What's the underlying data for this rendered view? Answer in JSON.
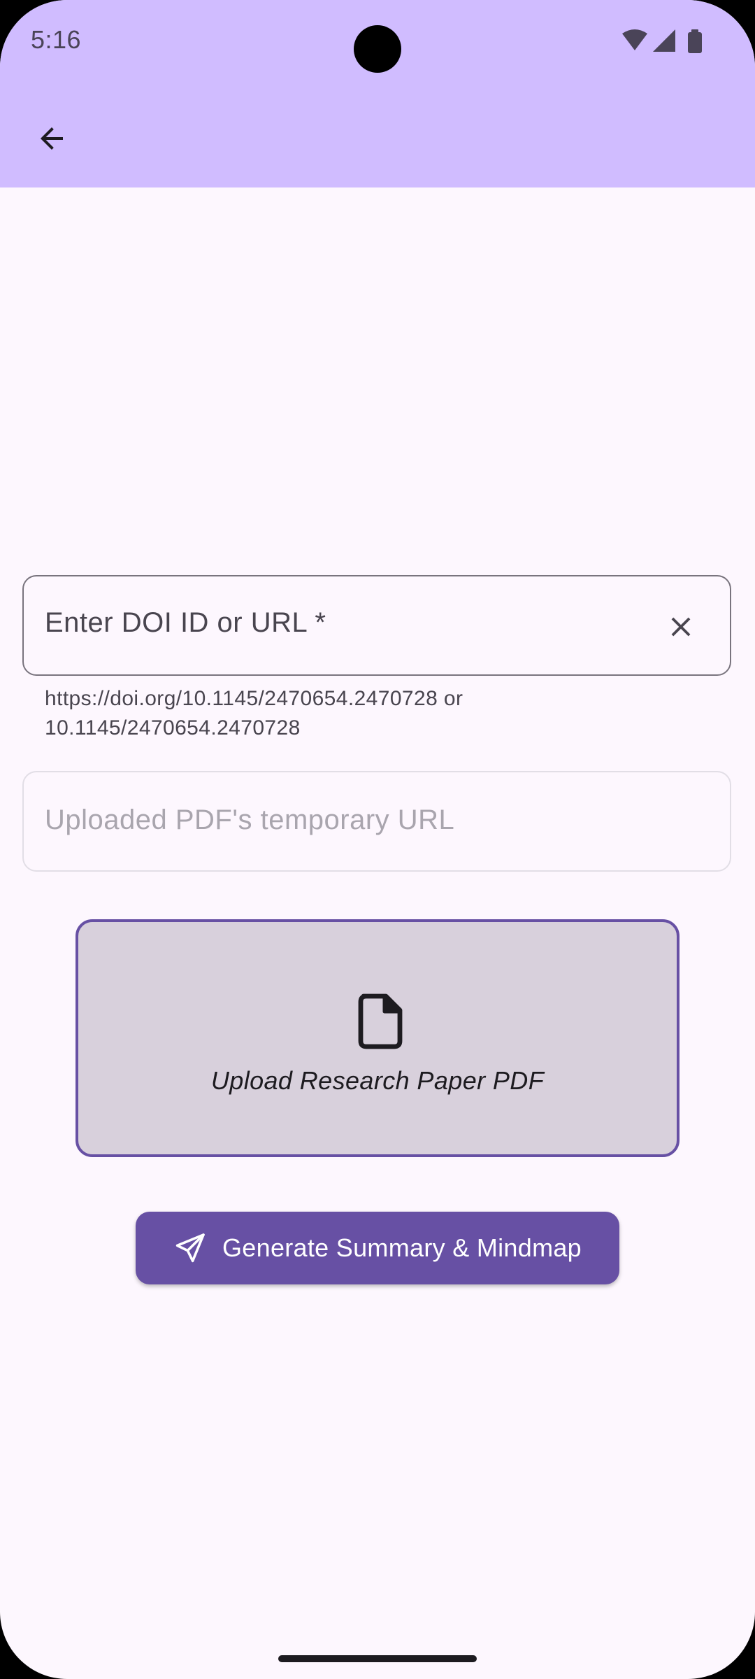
{
  "status_bar": {
    "time": "5:16"
  },
  "app_bar": {
    "back_icon": "arrow-back-icon",
    "background_color": "#D0BCFF"
  },
  "doi_input": {
    "label": "Enter DOI ID or URL *",
    "value": "",
    "helper_text": "https://doi.org/10.1145/2470654.2470728 or 10.1145/2470654.2470728",
    "clear_icon": "close-icon"
  },
  "pdf_url_input": {
    "placeholder": "Uploaded PDF's temporary URL",
    "value": "",
    "enabled": false
  },
  "upload_card": {
    "label": "Upload Research Paper PDF",
    "icon": "file-icon"
  },
  "generate_button": {
    "label": "Generate Summary & Mindmap",
    "icon": "send-icon",
    "color": "#6750A4"
  },
  "colors": {
    "accent": "#6750A4",
    "background": "#FDF7FE"
  }
}
